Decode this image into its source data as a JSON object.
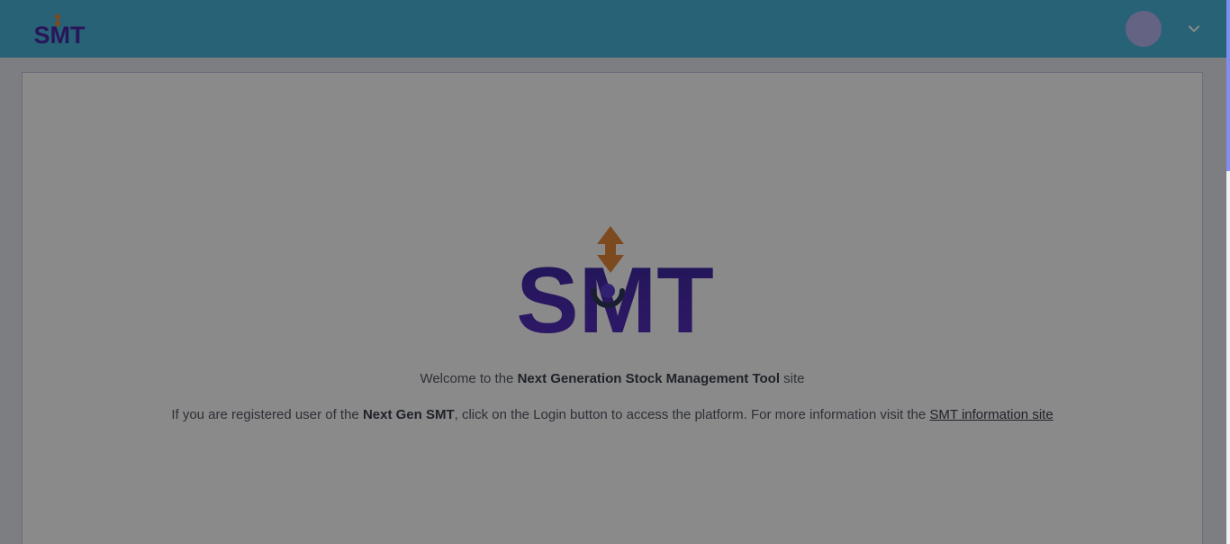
{
  "header": {
    "logo_text": "SMT",
    "logo_icon": "smt-logo-icon",
    "avatar_icon": "user-avatar",
    "menu_icon": "chevron-down-icon"
  },
  "main": {
    "logo_text": "SMT",
    "welcome": {
      "prefix": "Welcome to the ",
      "highlight": "Next Generation Stock Management Tool",
      "suffix": " site"
    },
    "info": {
      "prefix": "If you are registered user of the ",
      "highlight": "Next Gen SMT",
      "middle": ", click on the Login button to access the platform. For more information visit the ",
      "link": "SMT information site"
    }
  },
  "colors": {
    "header": "#48b5dc",
    "avatar": "#b9b8f4",
    "logo_purple": "#4a2aa4",
    "logo_orange": "#e8893a",
    "overlay": "rgba(0,0,0,0.46)",
    "scroll_thumb": "#7d8ff0"
  }
}
